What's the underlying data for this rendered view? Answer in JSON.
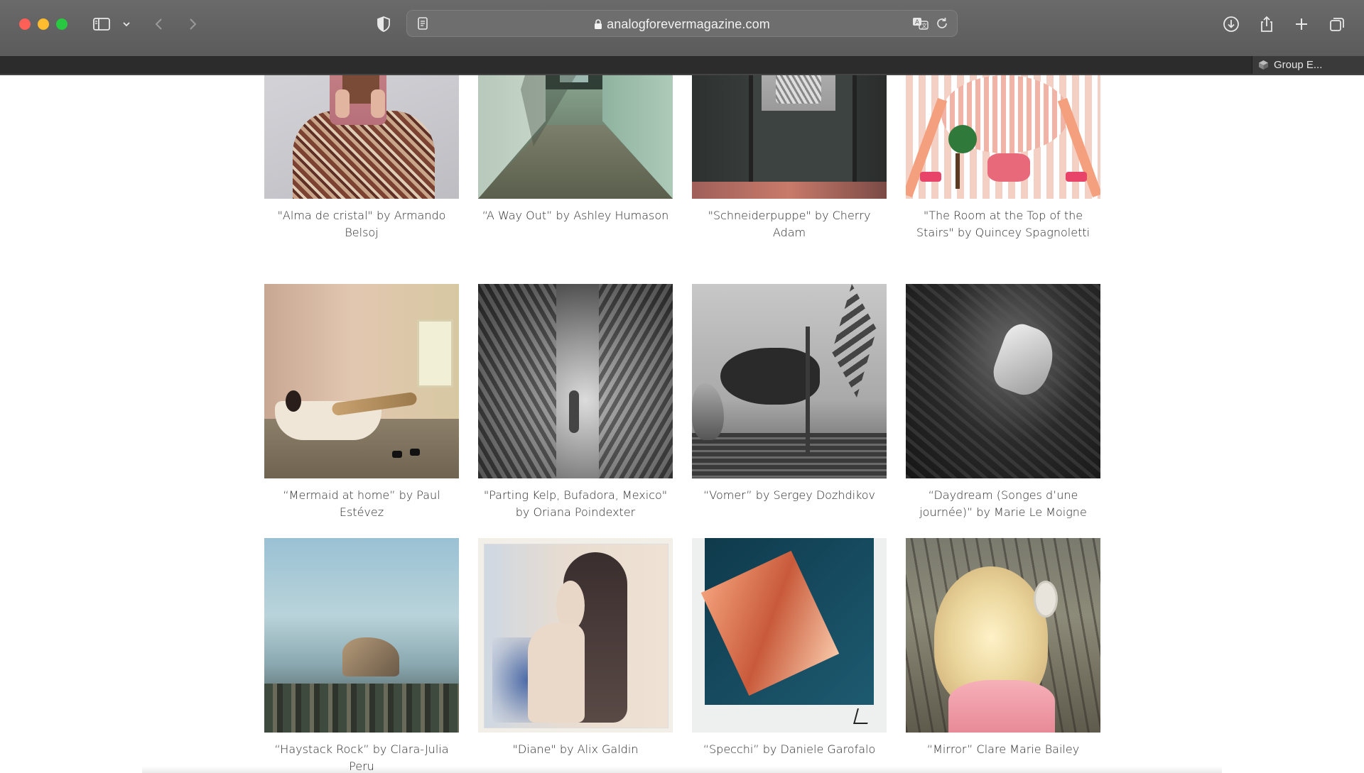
{
  "browser": {
    "url": "analogforevermagazine.com",
    "tab_label": "Group E..."
  },
  "gallery": {
    "items": [
      {
        "caption": "\"Alma de cristal\" by Armando Belsoj"
      },
      {
        "caption": "“A Way Out” by Ashley Humason"
      },
      {
        "caption": "\"Schneiderpuppe\" by Cherry Adam"
      },
      {
        "caption": "\"The Room at the Top of the Stairs\" by Quincey Spagnoletti"
      },
      {
        "caption": "“Mermaid at home” by Paul Estévez"
      },
      {
        "caption": "\"Parting Kelp, Bufadora, Mexico\" by Oriana Poindexter"
      },
      {
        "caption": "“Vomer” by Sergey Dozhdikov"
      },
      {
        "caption": "“Daydream (Songes d’une journée)” by Marie Le Moigne"
      },
      {
        "caption": "“Haystack Rock” by Clara-Julia Peru"
      },
      {
        "caption": "\"Diane\" by Alix Galdin"
      },
      {
        "caption": "“Specchi” by Daniele Garofalo"
      },
      {
        "caption": "“Mirror” Clare Marie Bailey"
      }
    ]
  },
  "colors": {
    "toolbar": "#606060",
    "tabstrip": "#2c2c2c",
    "caption_text": "#2a2a2a"
  }
}
